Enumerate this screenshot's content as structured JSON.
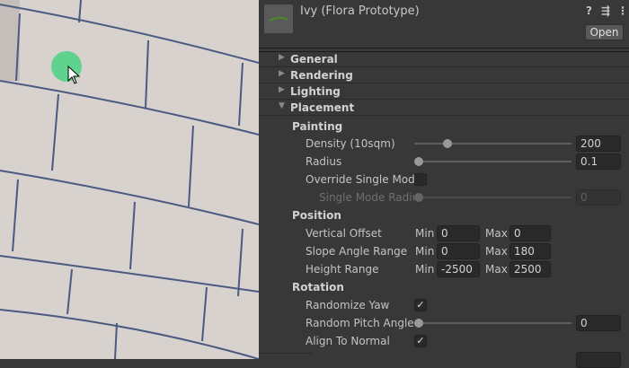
{
  "inspector": {
    "title": "Ivy (Flora Prototype)",
    "header_icons": [
      "help-icon",
      "preset-icon",
      "more-icon"
    ],
    "open_label": "Open",
    "foldouts": [
      {
        "label": "General",
        "expanded": false
      },
      {
        "label": "Rendering",
        "expanded": false
      },
      {
        "label": "Lighting",
        "expanded": false
      },
      {
        "label": "Placement",
        "expanded": true
      }
    ],
    "painting": {
      "header": "Painting",
      "density": {
        "label": "Density (10sqm)",
        "value": "200",
        "slider_fraction": 0.19
      },
      "radius": {
        "label": "Radius",
        "value": "0.1",
        "slider_fraction": 0.0
      },
      "override": {
        "label": "Override Single Mode",
        "checked": false
      },
      "single_radius": {
        "label": "Single Mode Radius",
        "value": "0",
        "slider_fraction": 0.0
      }
    },
    "position": {
      "header": "Position",
      "min_label": "Min",
      "max_label": "Max",
      "rows": [
        {
          "label": "Vertical Offset",
          "min": "0",
          "max": "0"
        },
        {
          "label": "Slope Angle Range",
          "min": "0",
          "max": "180"
        },
        {
          "label": "Height Range",
          "min": "-2500",
          "max": "2500"
        }
      ]
    },
    "rotation": {
      "header": "Rotation",
      "randomize_yaw": {
        "label": "Randomize Yaw",
        "checked": true
      },
      "random_pitch": {
        "label": "Random Pitch Angle",
        "value": "0",
        "slider_fraction": 0.0
      },
      "align_normal": {
        "label": "Align To Normal",
        "checked": true
      }
    }
  },
  "colors": {
    "brush": "#5fd38d",
    "panel": "#383838"
  }
}
